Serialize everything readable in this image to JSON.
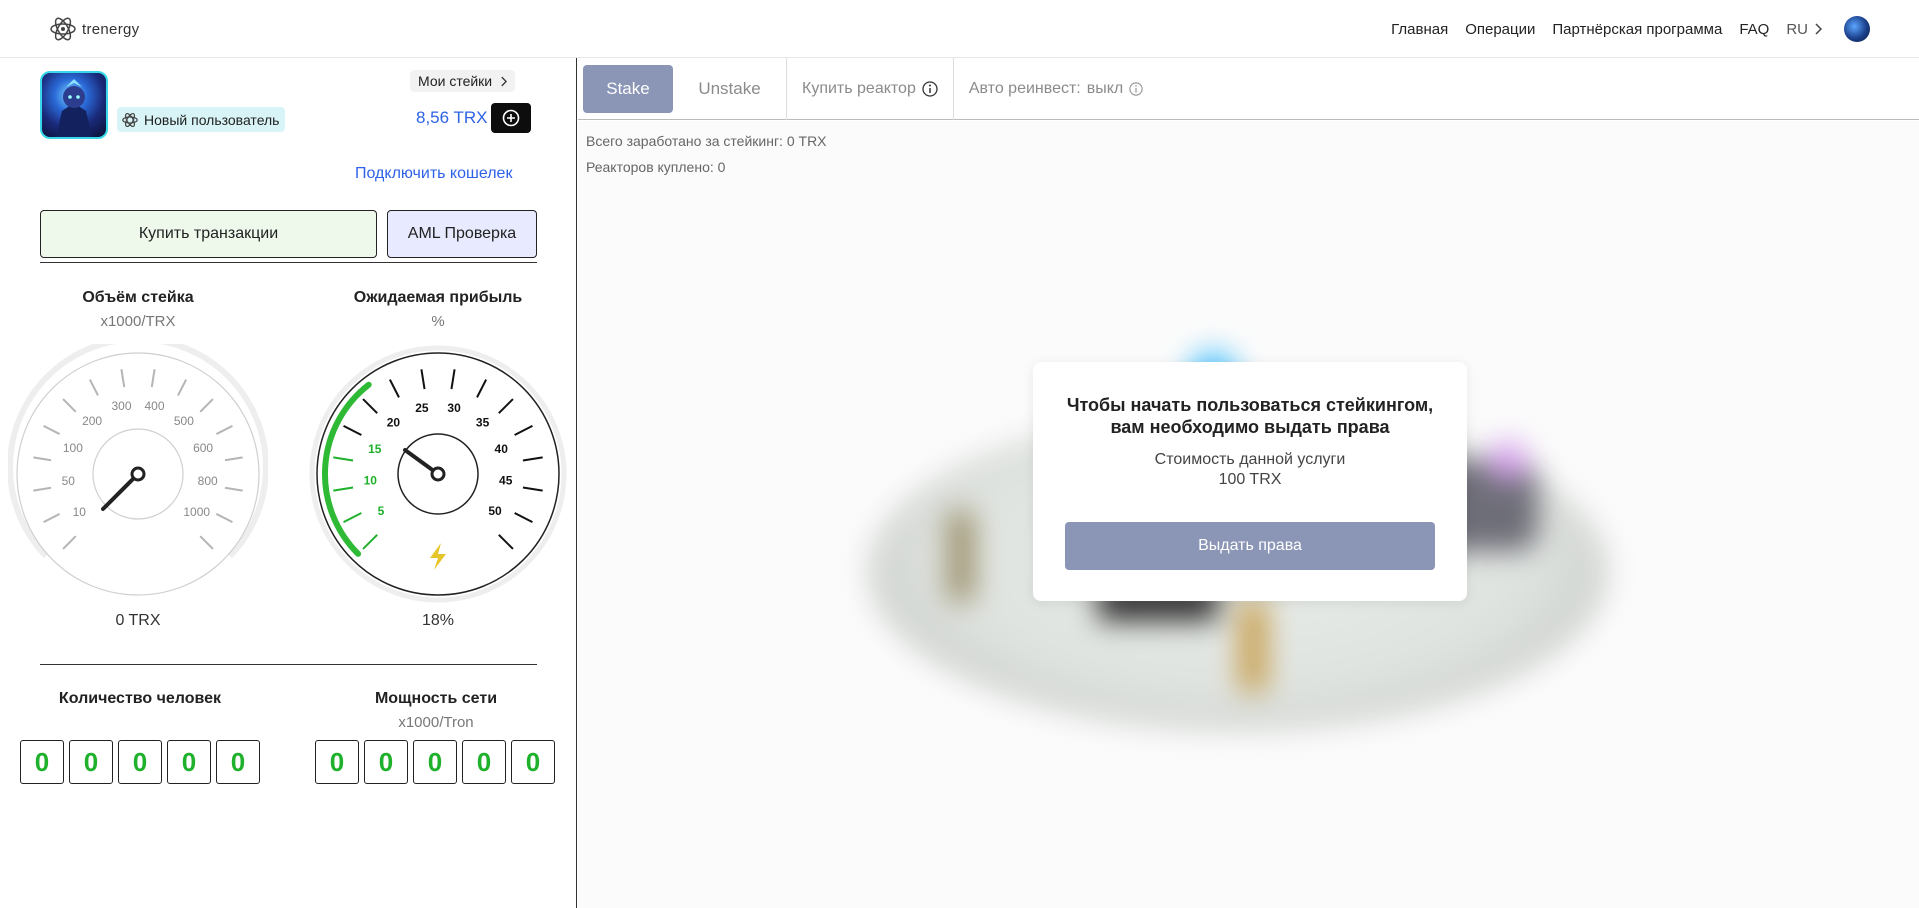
{
  "header": {
    "logo_text": "trenergy",
    "nav": [
      "Главная",
      "Операции",
      "Партнёрская программа",
      "FAQ"
    ],
    "lang": "RU"
  },
  "user": {
    "badge": "Новый пользователь",
    "my_stakes": "Мои стейки",
    "balance": "8,56 TRX",
    "connect_wallet": "Подключить кошелек"
  },
  "actions": {
    "buy_transactions": "Купить транзакции",
    "aml_check": "AML Проверка"
  },
  "gauges": {
    "stake": {
      "title": "Объём стейка",
      "unit": "x1000/TRX",
      "value": "0 TRX",
      "ticks": [
        "10",
        "50",
        "100",
        "200",
        "300",
        "400",
        "500",
        "600",
        "800",
        "1000"
      ]
    },
    "profit": {
      "title": "Ожидаемая прибыль",
      "unit": "%",
      "value": "18%",
      "ticks": [
        "5",
        "10",
        "15",
        "20",
        "25",
        "30",
        "35",
        "40",
        "45",
        "50"
      ],
      "level": 18
    }
  },
  "counters": {
    "people": {
      "title": "Количество человек",
      "digits": [
        "0",
        "0",
        "0",
        "0",
        "0"
      ]
    },
    "network": {
      "title": "Мощность сети",
      "unit": "x1000/Tron",
      "digits": [
        "0",
        "0",
        "0",
        "0",
        "0"
      ]
    }
  },
  "tabs": {
    "stake": "Stake",
    "unstake": "Unstake",
    "buy_reactor": "Купить реактор",
    "auto_reinvest": "Авто реинвест:",
    "auto_reinvest_state": "выкл"
  },
  "stats": {
    "total_earned": "Всего заработано за стейкинг: 0 TRX",
    "reactors_bought": "Реакторов куплено: 0"
  },
  "modal": {
    "title": "Чтобы начать пользоваться стейкингом, вам необходимо выдать права",
    "cost_label": "Стоимость данной услуги",
    "cost_value": "100 TRX",
    "button": "Выдать права"
  },
  "colors": {
    "accent_blue": "#2e62e6",
    "green": "#1fb12b",
    "tab_active": "#8b95b6"
  }
}
